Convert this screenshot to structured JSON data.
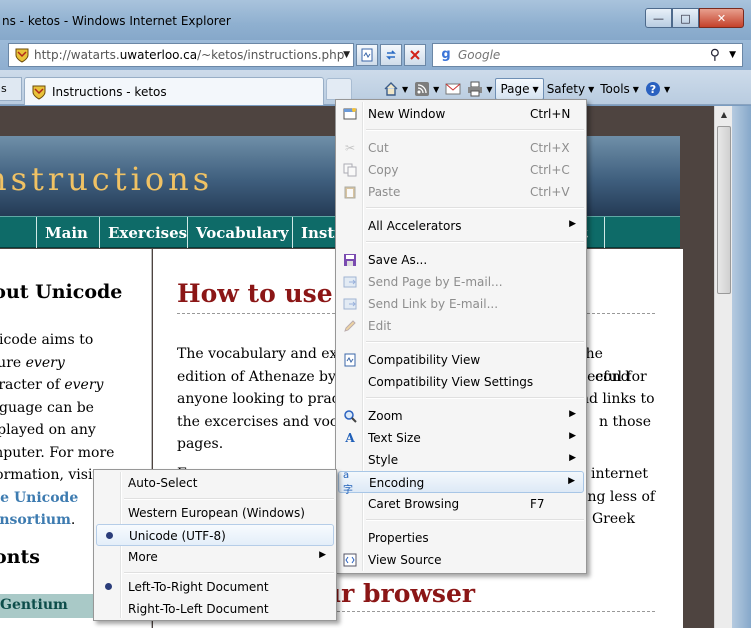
{
  "window": {
    "title": "ns - ketos - Windows Internet Explorer",
    "minimize_glyph": "—",
    "maximize_glyph": "□",
    "close_glyph": "✕"
  },
  "address": {
    "url_prefix": "http://watarts.",
    "url_domain": "uwaterloo.ca",
    "url_path": "/~ketos/instructions.php"
  },
  "search": {
    "placeholder": "Google"
  },
  "tabs": {
    "prev_label": "s",
    "active_title": "Instructions - ketos"
  },
  "commandbar": {
    "page": "Page",
    "safety": "Safety",
    "tools": "Tools"
  },
  "site": {
    "banner_title": "nstructions",
    "nav": [
      "Main",
      "Exercises",
      "Vocabulary",
      "Instr",
      "t"
    ],
    "sidebar": {
      "heading": "bout Unicode",
      "para_line1": "nicode aims to",
      "para_line2a": "sure ",
      "para_line2b": "every",
      "para_line3a": "aracter of ",
      "para_line3b": "every",
      "para_line4": "nguage can be",
      "para_line5": "splayed on any",
      "para_line6": "mputer. For more",
      "para_line7": "formation, visit",
      "link1": "he Unicode",
      "link2": "onsortium",
      "link_end": ".",
      "fonts": "onts",
      "gentium": "Gentium"
    },
    "main": {
      "heading": "How to use th",
      "p1_l1": "The vocabulary and exe",
      "p1_l1r": "the second",
      "p1_l2": "edition of Athenaze by",
      "p1_l2r": "eful for",
      "p1_l3": "anyone looking to pract",
      "p1_l3r": "nd links to",
      "p1_l4": "the excercises and vocal",
      "p1_l4r": "n those",
      "p1_l5": "pages.",
      "p2_l1": "F",
      "p2_l1r": "internet",
      "p2_l2r": "ing less of",
      "p2_l3r": "Greek",
      "heading2": "ur browser"
    }
  },
  "page_menu": {
    "items": [
      {
        "label": "New Window",
        "shortcut": "Ctrl+N",
        "icon": "new-window-icon"
      },
      {
        "label": "Cut",
        "shortcut": "Ctrl+X",
        "icon": "scissors-icon",
        "disabled": true
      },
      {
        "label": "Copy",
        "shortcut": "Ctrl+C",
        "icon": "copy-icon",
        "disabled": true
      },
      {
        "label": "Paste",
        "shortcut": "Ctrl+V",
        "icon": "paste-icon",
        "disabled": true
      },
      {
        "label": "All Accelerators",
        "submenu": true
      },
      {
        "label": "Save As...",
        "icon": "save-icon"
      },
      {
        "label": "Send Page by E-mail...",
        "icon": "mail-page-icon",
        "disabled": true
      },
      {
        "label": "Send Link by E-mail...",
        "icon": "mail-link-icon",
        "disabled": true
      },
      {
        "label": "Edit",
        "icon": "pencil-icon",
        "disabled": true
      },
      {
        "label": "Compatibility View",
        "icon": "compat-view-icon"
      },
      {
        "label": "Compatibility View Settings"
      },
      {
        "label": "Zoom",
        "icon": "zoom-icon",
        "submenu": true
      },
      {
        "label": "Text Size",
        "icon": "text-size-icon",
        "submenu": true
      },
      {
        "label": "Style",
        "submenu": true
      },
      {
        "label": "Encoding",
        "icon": "encoding-icon",
        "submenu": true,
        "highlighted": true
      },
      {
        "label": "Caret Browsing",
        "shortcut": "F7"
      },
      {
        "label": "Properties"
      },
      {
        "label": "View Source",
        "icon": "view-source-icon"
      }
    ]
  },
  "encoding_menu": {
    "items": [
      {
        "label": "Auto-Select"
      },
      {
        "label": "Western European (Windows)"
      },
      {
        "label": "Unicode (UTF-8)",
        "selected": true
      },
      {
        "label": "More",
        "submenu": true
      },
      {
        "label": "Left-To-Right Document",
        "selected": true
      },
      {
        "label": "Right-To-Left Document"
      }
    ]
  },
  "colors": {
    "menu_highlight": "#dde9f6",
    "nav_teal": "#0e6b68",
    "heading_red": "#8b1616",
    "banner_gold": "#f0c264"
  }
}
